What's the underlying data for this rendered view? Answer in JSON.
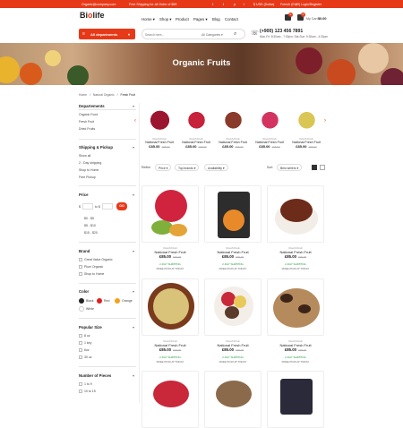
{
  "topbar": {
    "email": "Organic@company.com",
    "shipping": "Free Shipping for all Order of $99",
    "social": [
      "f",
      "t",
      "p",
      "i"
    ],
    "currency": "$ USD (Dollar)",
    "language": "French (EUR)",
    "login": "Login/Register"
  },
  "header": {
    "logo_prefix": "Bi",
    "logo_o": "o",
    "logo_suffix": "life",
    "nav": [
      "Home ▾",
      "Shop ▾",
      "Product",
      "Pages ▾",
      "Blog",
      "Contact"
    ],
    "cart_label": "My Cart",
    "cart_total": "$0.00",
    "cart_count": "0",
    "wish_count": "0"
  },
  "search": {
    "departments": "All departments",
    "placeholder": "Search here...",
    "category": "All Categories ▾",
    "phone": "(+900) 123 456 7891",
    "hours": "Mon-Fri: 8:30am - 7:30pm; Sat-Sun: 9:30am - 4:30pm"
  },
  "banner": {
    "title": "Organic Fruits"
  },
  "breadcrumb": [
    "Home",
    "Natural Organic",
    "Fresh Fruit"
  ],
  "sidebar": {
    "departments": {
      "title": "Departements",
      "items": [
        "Organic Food",
        "Fresh Fruit",
        "Dried Fruits"
      ]
    },
    "shipping": {
      "title": "Shipping & Pickup",
      "items": [
        "Show all",
        "2 - Day shipping",
        "Shop to Home",
        "Free Pickup"
      ]
    },
    "price": {
      "title": "Price",
      "from": "$",
      "to": "to $",
      "go": "GO",
      "ranges": [
        "$0 - $5",
        "$5 - $10",
        "$15 - $20"
      ]
    },
    "brand": {
      "title": "Brand",
      "items": [
        "Great Value Organic",
        "Plum Organic",
        "Shop to Home"
      ]
    },
    "color": {
      "title": "Color",
      "items": [
        "Black",
        "Red",
        "Orange",
        "White"
      ]
    },
    "popular_size": {
      "title": "Popular Size",
      "items": [
        "8 oz",
        "1 key",
        "6oz",
        "30 oz"
      ]
    },
    "pieces": {
      "title": "Number of Pieces",
      "items": [
        "1 to 9",
        "10 to 15"
      ]
    }
  },
  "carousel": {
    "products": [
      {
        "cat": "Fresh Fruit",
        "name": "National Fresh Fruit",
        "price": "£85.00",
        "old": "£95.00"
      },
      {
        "cat": "Fresh Fruit",
        "name": "National Fresh Fruit",
        "price": "£85.00",
        "old": "£95.00"
      },
      {
        "cat": "Fresh Fruit",
        "name": "National Fresh Fruit",
        "price": "£85.00",
        "old": "£95.00"
      },
      {
        "cat": "Fresh Fruit",
        "name": "National Fresh Fruit",
        "price": "£85.00",
        "old": "£95.00"
      },
      {
        "cat": "Fresh Fruit",
        "name": "National Fresh Fruit",
        "price": "£85.00",
        "old": "£95.00"
      }
    ]
  },
  "filters": {
    "refine": "Refine",
    "price": "Price ▾",
    "brands": "Top brands ▾",
    "availability": "Availability ▾",
    "sort": "Sort",
    "sort_value": "Best sellers ▾"
  },
  "grid": {
    "products": [
      {
        "cat": "Fresh Fruit",
        "name": "National Fresh Fruit",
        "price": "£85.00",
        "old": "£95.00",
        "ship": "2-DAY SHIPPING",
        "pick": "FREE PICKUP TODAY"
      },
      {
        "cat": "Fresh Fruit",
        "name": "National Fresh Fruit",
        "price": "£85.00",
        "old": "£95.00",
        "ship": "2-DAY SHIPPING",
        "pick": "FREE PICKUP TODAY"
      },
      {
        "cat": "Fresh Fruit",
        "name": "National Fresh Fruit",
        "price": "£85.00",
        "old": "£95.00",
        "ship": "2-DAY SHIPPING",
        "pick": "FREE PICKUP TODAY"
      },
      {
        "cat": "Fresh Fruit",
        "name": "National Fresh Fruit",
        "price": "£85.00",
        "old": "£95.00",
        "ship": "2-DAY SHIPPING",
        "pick": "FREE PICKUP TODAY"
      },
      {
        "cat": "Fresh Fruit",
        "name": "National Fresh Fruit",
        "price": "£85.00",
        "old": "£95.00",
        "ship": "2-DAY SHIPPING",
        "pick": "FREE PICKUP TODAY"
      },
      {
        "cat": "Fresh Fruit",
        "name": "National Fresh Fruit",
        "price": "£85.00",
        "old": "£95.00",
        "ship": "2-DAY SHIPPING",
        "pick": "FREE PICKUP TODAY"
      }
    ]
  },
  "colors": {
    "accent": "#e73918",
    "green": "#23a047"
  }
}
